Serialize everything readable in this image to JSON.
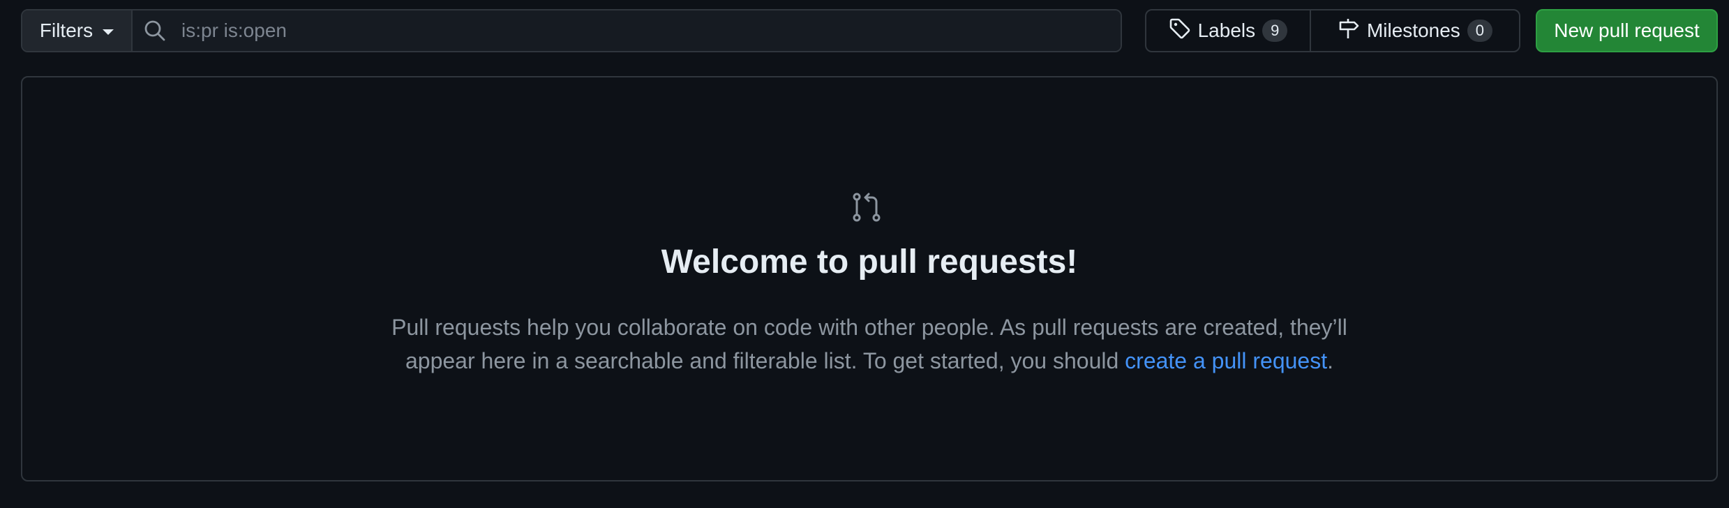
{
  "toolbar": {
    "filters_label": "Filters",
    "search_value": "is:pr is:open",
    "labels_label": "Labels",
    "labels_count": "9",
    "milestones_label": "Milestones",
    "milestones_count": "0",
    "new_pr_label": "New pull request"
  },
  "blankslate": {
    "title": "Welcome to pull requests!",
    "description_before": "Pull requests help you collaborate on code with other people. As pull requests are created, they’ll appear here in a searchable and filterable list. To get started, you should ",
    "link_text": "create a pull request",
    "description_after": "."
  },
  "colors": {
    "background": "#0d1117",
    "border": "#30363d",
    "primary_button": "#238636",
    "link": "#4493f8",
    "muted_text": "#8d96a0"
  },
  "icons": [
    "caret-down-icon",
    "search-icon",
    "tag-icon",
    "milestone-icon",
    "git-pull-request-icon"
  ]
}
